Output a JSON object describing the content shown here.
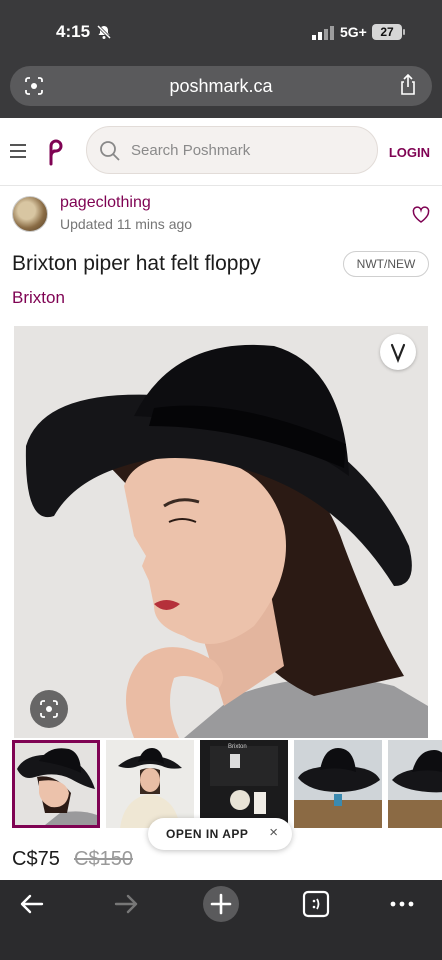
{
  "status_bar": {
    "time": "4:15",
    "network": "5G+",
    "battery": "27"
  },
  "url_bar": {
    "url": "poshmark.ca"
  },
  "header": {
    "search_placeholder": "Search Poshmark",
    "login_label": "LOGIN"
  },
  "seller": {
    "name": "pageclothing",
    "updated": "Updated 11 mins ago"
  },
  "listing": {
    "title": "Brixton piper hat felt floppy",
    "condition": "NWT/NEW",
    "brand": "Brixton",
    "price": "C$75",
    "original_price": "C$150"
  },
  "thumbnails": [
    "thumb-1",
    "thumb-2",
    "thumb-3",
    "thumb-4",
    "thumb-5"
  ],
  "thumb_label": "Brixton",
  "open_in_app": {
    "label": "OPEN IN APP",
    "close": "×"
  },
  "colors": {
    "brand": "#7f0353",
    "chrome": "#3a3a3c"
  }
}
